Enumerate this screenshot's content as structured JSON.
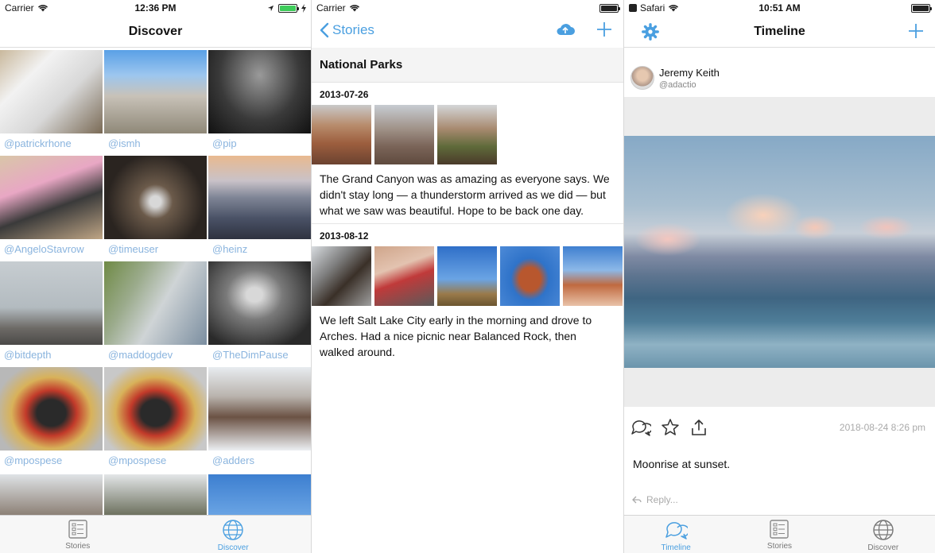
{
  "colors": {
    "accent": "#4a9fe0",
    "handle": "#8ab4de",
    "charging": "#3ecc5a"
  },
  "discover": {
    "status": {
      "carrier": "Carrier",
      "time": "12:36 PM"
    },
    "title": "Discover",
    "cells": [
      {
        "user": "@patrickrhone"
      },
      {
        "user": "@ismh"
      },
      {
        "user": "@pip"
      },
      {
        "user": "@AngeloStavrow"
      },
      {
        "user": "@timeuser"
      },
      {
        "user": "@heinz"
      },
      {
        "user": "@bitdepth"
      },
      {
        "user": "@maddogdev"
      },
      {
        "user": "@TheDimPause"
      },
      {
        "user": "@mpospese"
      },
      {
        "user": "@mpospese"
      },
      {
        "user": "@adders"
      }
    ],
    "tabs": {
      "stories": "Stories",
      "discover": "Discover"
    }
  },
  "stories": {
    "status": {
      "carrier": "Carrier"
    },
    "back_label": "Stories",
    "story_title": "National Parks",
    "entries": [
      {
        "date": "2013-07-26",
        "text": "The Grand Canyon was as amazing as everyone says. We didn't stay long — a thunderstorm arrived as we did — but what we saw was beautiful. Hope to be back one day."
      },
      {
        "date": "2013-08-12",
        "text": "We left Salt Lake City early in the morning and drove to Arches. Had a nice picnic near Balanced Rock, then walked around."
      }
    ]
  },
  "timeline": {
    "status": {
      "app": "Safari",
      "time": "10:51 AM"
    },
    "title": "Timeline",
    "post": {
      "name": "Jeremy Keith",
      "handle": "@adactio",
      "timestamp": "2018-08-24  8:26 pm",
      "caption": "Moonrise at sunset.",
      "reply_placeholder": "Reply..."
    },
    "tabs": {
      "timeline": "Timeline",
      "stories": "Stories",
      "discover": "Discover"
    }
  }
}
